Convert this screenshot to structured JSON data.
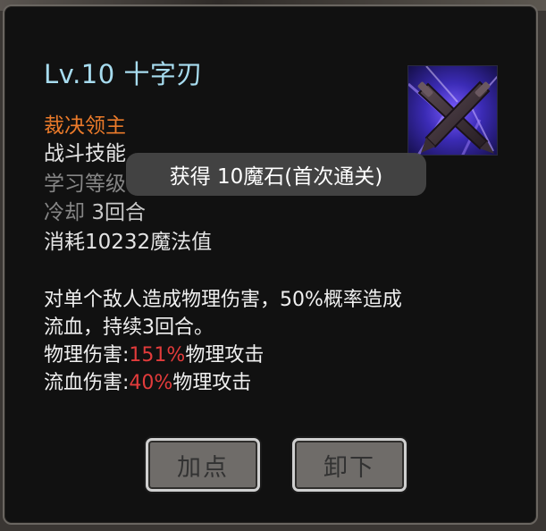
{
  "skill": {
    "title": "Lv.10 十字刃",
    "icon": "crossed-daggers-icon",
    "source": "裁决领主",
    "category": "战斗技能",
    "requirement": "学习等级",
    "cooldown_label": "冷却",
    "cooldown_value": "3回合",
    "cost": "消耗10232魔法值"
  },
  "description": {
    "line1": "对单个敌人造成物理伤害，50%概率造成",
    "line2": "流血，持续3回合。",
    "physical_label": "物理伤害:",
    "physical_value": "151%",
    "physical_suffix": "物理攻击",
    "bleed_label": "流血伤害:",
    "bleed_value": "40%",
    "bleed_suffix": "物理攻击"
  },
  "toast": {
    "text": "获得 10魔石(首次通关)"
  },
  "buttons": {
    "upgrade": "加点",
    "unequip": "卸下"
  },
  "colors": {
    "title": "#a7dcef",
    "source": "#ea7a2a",
    "highlight": "#e23b3b",
    "panel": "#111111"
  }
}
